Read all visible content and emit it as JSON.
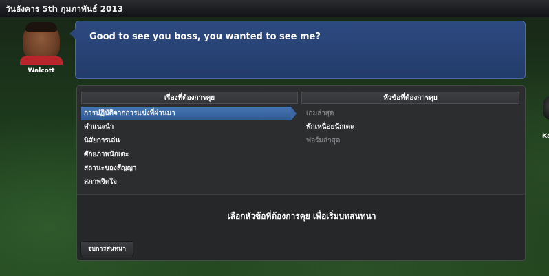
{
  "topbar": {
    "date": "วันอังคาร 5th กุมภาพันธ์ 2013"
  },
  "player": {
    "name": "Walcott"
  },
  "speech": {
    "text": "Good to see you boss, you wanted to see me?"
  },
  "panel": {
    "left_header": "เรื่องที่ต้องการคุย",
    "right_header": "หัวข้อที่ต้องการคุย",
    "topics": [
      {
        "label": "การปฏิบัติจากการแข่งที่ผ่านมา",
        "selected": true
      },
      {
        "label": "คำแนะนำ"
      },
      {
        "label": "นิสัยการเล่น"
      },
      {
        "label": "ศักยภาพนักเตะ"
      },
      {
        "label": "สถานะของสัญญา"
      },
      {
        "label": "สภาพจิตใจ"
      }
    ],
    "subtopics": [
      {
        "label": "เกมล่าสุด",
        "enabled": false
      },
      {
        "label": "พักเหนื่อยนักเตะ",
        "enabled": true
      },
      {
        "label": "ฟอร์มล่าสุด",
        "enabled": false
      }
    ],
    "prompt": "เลือกหัวข้อที่ต้องการคุย   เพื่อเริ่มบทสนทนา",
    "end_button": "จบการสนทนา"
  },
  "edge": {
    "name_fragment": "Ka"
  },
  "colors": {
    "accent": "#3a68a4",
    "speech_bg": "#2a4677",
    "panel_bg": "#2c2d2f"
  }
}
